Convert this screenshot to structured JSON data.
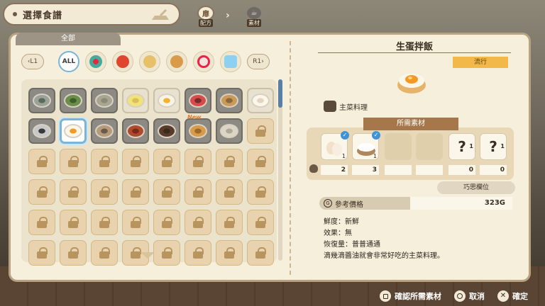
{
  "header": {
    "title": "選擇食譜",
    "step1_label": "配方",
    "step2_label": "素材",
    "step1_glyph": "扉",
    "step2_glyph": "☕"
  },
  "left": {
    "category_header": "全部",
    "l_button": "L1",
    "r_button": "R1",
    "all_label": "ALL",
    "new_tag": "New"
  },
  "recipe": {
    "name": "生蛋拌飯",
    "trend": "流行",
    "type": "主菜料理",
    "materials_header": "所需素材",
    "materials": [
      {
        "name": "egg",
        "required": "1",
        "have": "2",
        "status": "have"
      },
      {
        "name": "rice",
        "required": "1",
        "have": "3",
        "status": "have"
      },
      {
        "name": "",
        "required": "",
        "have": "",
        "status": "empty"
      },
      {
        "name": "",
        "required": "",
        "have": "",
        "status": "empty"
      },
      {
        "name": "?",
        "required": "1",
        "have": "0",
        "status": "unknown"
      },
      {
        "name": "?",
        "required": "1",
        "have": "0",
        "status": "unknown"
      }
    ],
    "skill_slot": "巧思欄位",
    "price_label": "參考價格",
    "price_coin": "G",
    "price_value": "323G",
    "freshness": "鮮度：新鮮",
    "effect": "效果：無",
    "recovery": "恢復量：普普通通",
    "description": "滴幾滴醬油就會非常好吃的主菜料理。"
  },
  "footer": {
    "confirm_materials": "確認所需素材",
    "cancel": "取消",
    "confirm": "確定",
    "x_glyph": "✕"
  },
  "colors": {
    "accent_blue": "#7ab4d6",
    "panel_bg": "#f6efdc",
    "trend_badge": "#f2b84a"
  }
}
